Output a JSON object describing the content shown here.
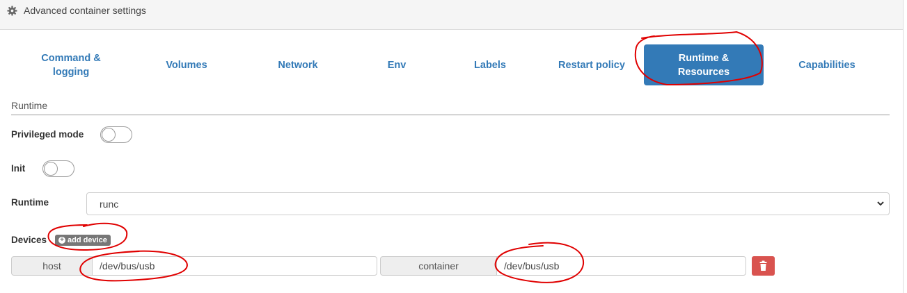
{
  "panel": {
    "title": "Advanced container settings",
    "icon": "gear-icon"
  },
  "tabs": [
    {
      "line1": "Command &",
      "line2": "logging",
      "active": false
    },
    {
      "line1": "Volumes",
      "line2": "",
      "active": false
    },
    {
      "line1": "Network",
      "line2": "",
      "active": false
    },
    {
      "line1": "Env",
      "line2": "",
      "active": false
    },
    {
      "line1": "Labels",
      "line2": "",
      "active": false
    },
    {
      "line1": "Restart policy",
      "line2": "",
      "active": false
    },
    {
      "line1": "Runtime &",
      "line2": "Resources",
      "active": true
    },
    {
      "line1": "Capabilities",
      "line2": "",
      "active": false
    }
  ],
  "runtime_section": {
    "title": "Runtime",
    "privileged_mode": {
      "label": "Privileged mode",
      "enabled": false
    },
    "init": {
      "label": "Init",
      "enabled": false
    },
    "runtime": {
      "label": "Runtime",
      "value": "runc"
    }
  },
  "devices": {
    "label": "Devices",
    "add_button": "add device",
    "rows": [
      {
        "host_label": "host",
        "host_value": "/dev/bus/usb",
        "container_label": "container",
        "container_value": "/dev/bus/usb"
      }
    ]
  },
  "colors": {
    "accent": "#337ab7",
    "danger": "#d9534f",
    "annotation": "#e00000"
  }
}
